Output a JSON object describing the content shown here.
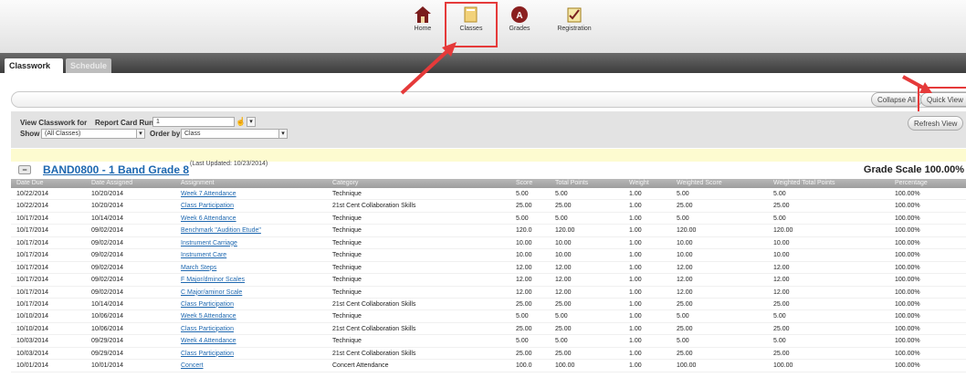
{
  "nav": {
    "items": [
      {
        "label": "Home",
        "icon": "home-icon"
      },
      {
        "label": "Classes",
        "icon": "classes-icon"
      },
      {
        "label": "Grades",
        "icon": "grades-icon"
      },
      {
        "label": "Registration",
        "icon": "registration-icon"
      }
    ],
    "highlight_color": "#e53a3a"
  },
  "tabs": [
    {
      "label": "Classwork",
      "active": true
    },
    {
      "label": "Schedule",
      "active": false
    }
  ],
  "toolbar": {
    "collapse_all": "Collapse All",
    "quick_view": "Quick View",
    "refresh_view": "Refresh View"
  },
  "filters": {
    "view_label": "View Classwork for",
    "report_card_label": "Report Card Run",
    "report_card_value": "1",
    "show_label": "Show",
    "show_value": "(All Classes)",
    "order_label": "Order by",
    "order_value": "Class"
  },
  "class": {
    "title": "BAND0800 - 1 Band Grade 8",
    "updated": "(Last Updated: 10/23/2014)",
    "grade_scale": "Grade Scale 100.00%"
  },
  "table": {
    "columns": [
      "Date Due",
      "Date Assigned",
      "Assignment",
      "Category",
      "Score",
      "Total Points",
      "Weight",
      "Weighted Score",
      "Weighted Total Points",
      "Percentage"
    ],
    "rows": [
      [
        "10/22/2014",
        "10/20/2014",
        "Week 7 Attendance",
        "Technique",
        "5.00",
        "5.00",
        "1.00",
        "5.00",
        "5.00",
        "100.00%"
      ],
      [
        "10/22/2014",
        "10/20/2014",
        "Class Participation",
        "21st Cent Collaboration Skills",
        "25.00",
        "25.00",
        "1.00",
        "25.00",
        "25.00",
        "100.00%"
      ],
      [
        "10/17/2014",
        "10/14/2014",
        "Week 6 Attendance",
        "Technique",
        "5.00",
        "5.00",
        "1.00",
        "5.00",
        "5.00",
        "100.00%"
      ],
      [
        "10/17/2014",
        "09/02/2014",
        "Benchmark \"Audition Etude\"",
        "Technique",
        "120.0",
        "120.00",
        "1.00",
        "120.00",
        "120.00",
        "100.00%"
      ],
      [
        "10/17/2014",
        "09/02/2014",
        "Instrument Carriage",
        "Technique",
        "10.00",
        "10.00",
        "1.00",
        "10.00",
        "10.00",
        "100.00%"
      ],
      [
        "10/17/2014",
        "09/02/2014",
        "Instrument Care",
        "Technique",
        "10.00",
        "10.00",
        "1.00",
        "10.00",
        "10.00",
        "100.00%"
      ],
      [
        "10/17/2014",
        "09/02/2014",
        "March Steps",
        "Technique",
        "12.00",
        "12.00",
        "1.00",
        "12.00",
        "12.00",
        "100.00%"
      ],
      [
        "10/17/2014",
        "09/02/2014",
        "F Major/dminor Scales",
        "Technique",
        "12.00",
        "12.00",
        "1.00",
        "12.00",
        "12.00",
        "100.00%"
      ],
      [
        "10/17/2014",
        "09/02/2014",
        "C Major/aminor Scale",
        "Technique",
        "12.00",
        "12.00",
        "1.00",
        "12.00",
        "12.00",
        "100.00%"
      ],
      [
        "10/17/2014",
        "10/14/2014",
        "Class Participation",
        "21st Cent Collaboration Skills",
        "25.00",
        "25.00",
        "1.00",
        "25.00",
        "25.00",
        "100.00%"
      ],
      [
        "10/10/2014",
        "10/06/2014",
        "Week 5 Attendance",
        "Technique",
        "5.00",
        "5.00",
        "1.00",
        "5.00",
        "5.00",
        "100.00%"
      ],
      [
        "10/10/2014",
        "10/06/2014",
        "Class Participation",
        "21st Cent Collaboration Skills",
        "25.00",
        "25.00",
        "1.00",
        "25.00",
        "25.00",
        "100.00%"
      ],
      [
        "10/03/2014",
        "09/29/2014",
        "Week 4 Attendance",
        "Technique",
        "5.00",
        "5.00",
        "1.00",
        "5.00",
        "5.00",
        "100.00%"
      ],
      [
        "10/03/2014",
        "09/29/2014",
        "Class Participation",
        "21st Cent Collaboration Skills",
        "25.00",
        "25.00",
        "1.00",
        "25.00",
        "25.00",
        "100.00%"
      ],
      [
        "10/01/2014",
        "10/01/2014",
        "Concert",
        "Concert Attendance",
        "100.0",
        "100.00",
        "1.00",
        "100.00",
        "100.00",
        "100.00%"
      ]
    ]
  },
  "colors": {
    "link": "#1e68b0",
    "annotation": "#e53a3a"
  }
}
